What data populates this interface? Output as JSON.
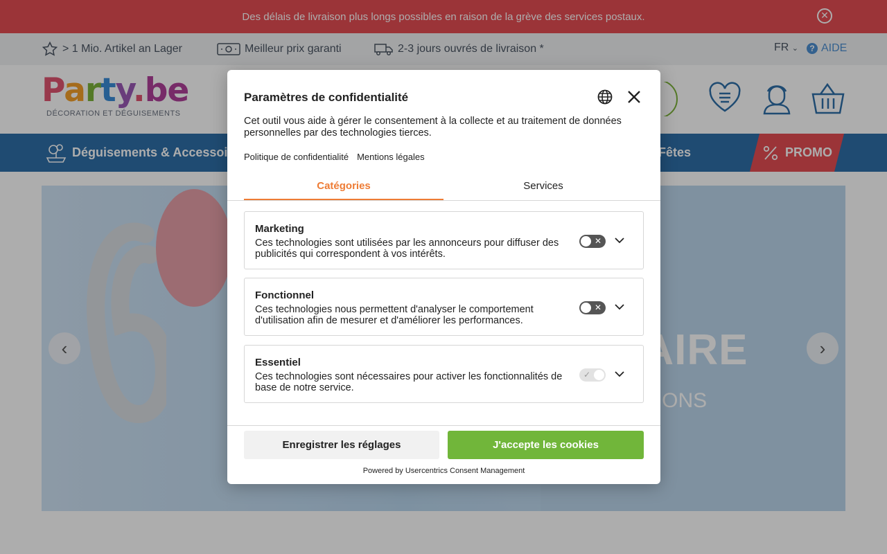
{
  "notice": {
    "text": "Des délais de livraison plus longs possibles en raison de la grève des services postaux."
  },
  "usp": {
    "items": [
      {
        "icon": "star-icon",
        "label": "> 1 Mio. Artikel an Lager"
      },
      {
        "icon": "banknote-icon",
        "label": "Meilleur prix garanti"
      },
      {
        "icon": "truck-icon",
        "label": "2-3 jours ouvrés de livraison *"
      }
    ],
    "lang": "FR",
    "help": "AIDE"
  },
  "logo": {
    "tagline": "DÉCORATION ET DÉGUISEMENTS"
  },
  "nav": {
    "items": [
      {
        "label": "Déguisements & Accessoires"
      },
      {
        "label": "Fêtes"
      }
    ],
    "promo": "PROMO"
  },
  "hero": {
    "big_text": "SAIRE",
    "sub_text": "RATIONS"
  },
  "modal": {
    "title": "Paramètres de confidentialité",
    "description": "Cet outil vous aide à gérer le consentement à la collecte et au traitement de données personnelles par des technologies tierces.",
    "links": {
      "privacy": "Politique de confidentialité",
      "legal": "Mentions légales"
    },
    "tabs": {
      "categories": "Catégories",
      "services": "Services"
    },
    "categories": [
      {
        "title": "Marketing",
        "description": "Ces technologies sont utilisées par les annonceurs pour diffuser des publicités qui correspondent à vos intérêts.",
        "enabled": false
      },
      {
        "title": "Fonctionnel",
        "description": "Ces technologies nous permettent d'analyser le comportement d'utilisation afin de mesurer et d'améliorer les performances.",
        "enabled": false
      },
      {
        "title": "Essentiel",
        "description": "Ces technologies sont nécessaires pour activer les fonctionnalités de base de notre service.",
        "enabled": true
      }
    ],
    "buttons": {
      "save": "Enregistrer les réglages",
      "accept": "J'accepte les cookies"
    },
    "powered_by": "Powered by Usercentrics Consent Management"
  },
  "colors": {
    "notice": "#e54d53",
    "nav": "#2f6fa8",
    "accent_orange": "#ee7c35",
    "accept_green": "#71b63a",
    "help_blue": "#4d8fd1"
  }
}
